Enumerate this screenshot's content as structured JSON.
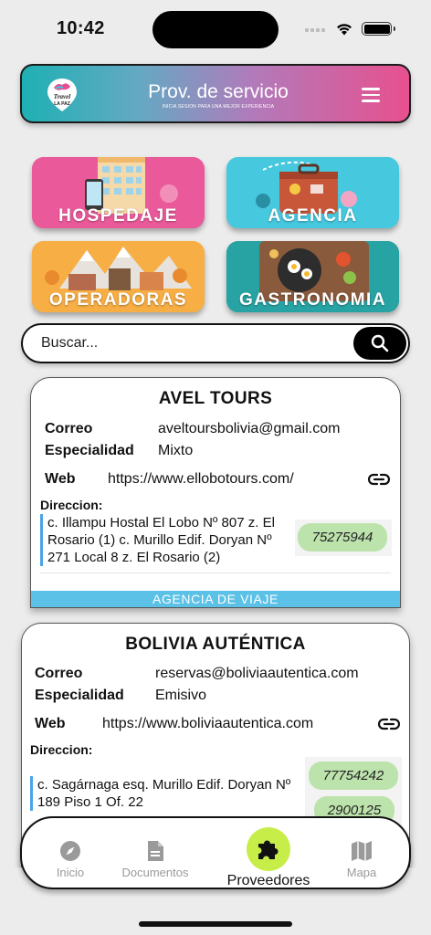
{
  "status_bar": {
    "time": "10:42"
  },
  "header": {
    "logo_text": "Travel LA PAZ",
    "title": "Prov. de servicio",
    "subtitle": "INICIA SESION PARA UNA MEJOR EXPERIENCIA",
    "menu_icon": "hamburger-menu-icon"
  },
  "categories": [
    {
      "label": "HOSPEDAJE",
      "color": "#e64d92"
    },
    {
      "label": "AGENCIA",
      "color": "#43c4dc"
    },
    {
      "label": "OPERADORAS",
      "color": "#f6a83b"
    },
    {
      "label": "GASTRONOMIA",
      "color": "#1f9ea0"
    }
  ],
  "search": {
    "placeholder": "Buscar...",
    "icon": "search-icon"
  },
  "providers": [
    {
      "name": "AVEL TOURS",
      "correo_label": "Correo",
      "correo": "aveltoursbolivia@gmail.com",
      "especialidad_label": "Especialidad",
      "especialidad": "Mixto",
      "web_label": "Web",
      "web": "https://www.ellobotours.com/",
      "direccion_label": "Direccion:",
      "direccion": "c. Illampu Hostal El Lobo Nº 807 z. El Rosario (1) c. Murillo Edif. Doryan Nº 271 Local 8 z. El Rosario (2)",
      "phones": [
        "75275944"
      ],
      "type": "AGENCIA DE VIAJE"
    },
    {
      "name": "BOLIVIA AUTÉNTICA",
      "correo_label": "Correo",
      "correo": "reservas@boliviaautentica.com",
      "especialidad_label": "Especialidad",
      "especialidad": "Emisivo",
      "web_label": "Web",
      "web": "https://www.boliviaautentica.com",
      "direccion_label": "Direccion:",
      "direccion": "c. Sagárnaga esq. Murillo Edif. Doryan Nº 189 Piso 1 Of. 22",
      "phones": [
        "77754242",
        "2900125"
      ]
    }
  ],
  "nav": {
    "items": [
      {
        "label": "Inicio",
        "icon": "compass-icon"
      },
      {
        "label": "Documentos",
        "icon": "document-icon"
      },
      {
        "label": "Proveedores",
        "icon": "puzzle-icon",
        "active": true
      },
      {
        "label": "Mapa",
        "icon": "map-icon"
      }
    ],
    "active_color": "#c7ee48"
  }
}
